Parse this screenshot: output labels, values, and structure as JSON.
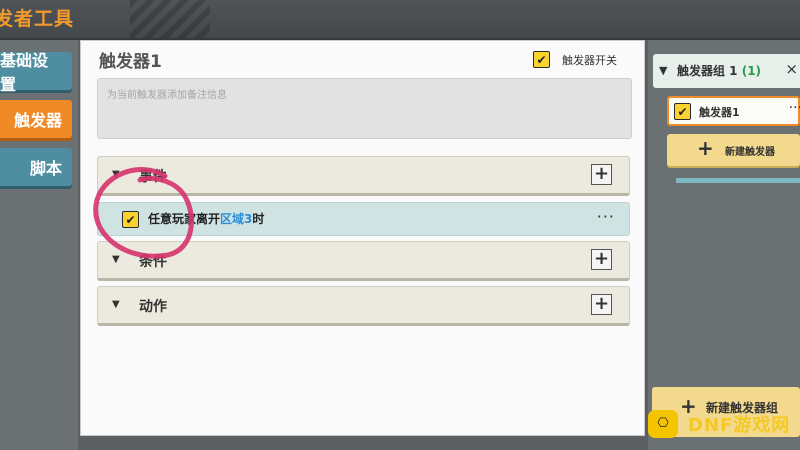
{
  "window": {
    "title": "发者工具"
  },
  "sidebar": {
    "items": [
      {
        "label": "基础设置"
      },
      {
        "label": "触发器"
      },
      {
        "label": "脚本"
      }
    ]
  },
  "main": {
    "trigger_title": "触发器1",
    "switch_label": "触发器开关",
    "note_placeholder": "为当前触发器添加备注信息",
    "sections": [
      {
        "label": "事件"
      },
      {
        "label": "条件"
      },
      {
        "label": "动作"
      }
    ],
    "event_row": {
      "prefix": "任意玩家离开",
      "highlight": "区域3",
      "suffix": "时",
      "more": "···"
    }
  },
  "right": {
    "group_name": "触发器组 1",
    "group_count": "(1)",
    "close": "×",
    "trigger_item": "触发器1",
    "trigger_more": "···",
    "new_trigger": "新建触发器",
    "new_group": "新建触发器组"
  },
  "watermark": {
    "text": "DNF游戏网"
  },
  "colors": {
    "accent": "#f08a26",
    "nav": "#4f8da0",
    "check": "#fbd331",
    "annotation": "#d6336c"
  }
}
